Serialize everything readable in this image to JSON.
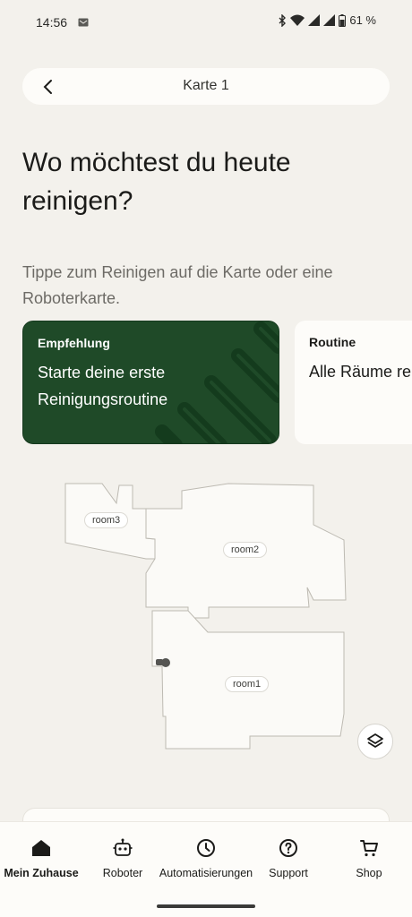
{
  "status_bar": {
    "time": "14:56",
    "battery": "61 %",
    "icons": [
      "message-icon",
      "bluetooth-icon",
      "wifi-icon",
      "signal-icon",
      "signal-icon",
      "battery-icon"
    ]
  },
  "header": {
    "title": "Karte 1",
    "back_icon": "chevron-left-icon"
  },
  "main": {
    "title": "Wo möchtest du heute reinigen?",
    "subtitle": "Tippe zum Reinigen auf die Karte oder eine Roboterkarte."
  },
  "cards": [
    {
      "kicker": "Empfehlung",
      "body": "Starte deine erste Reinigungsroutine",
      "color": "#1f4a28"
    },
    {
      "kicker": "Routine",
      "body": "Alle Räume re"
    }
  ],
  "map": {
    "rooms": [
      {
        "label": "room3"
      },
      {
        "label": "room2"
      },
      {
        "label": "room1"
      }
    ],
    "layers_icon": "layers-icon",
    "robot_icon": "robot-dock-icon"
  },
  "bottom_nav": {
    "items": [
      {
        "label": "Mein Zuhause",
        "icon": "home-icon",
        "active": true
      },
      {
        "label": "Roboter",
        "icon": "robot-icon",
        "active": false
      },
      {
        "label": "Automatisierungen",
        "icon": "clock-icon",
        "active": false
      },
      {
        "label": "Support",
        "icon": "help-icon",
        "active": false
      },
      {
        "label": "Shop",
        "icon": "cart-icon",
        "active": false
      }
    ]
  },
  "colors": {
    "background": "#f3f1ec",
    "accent_green": "#1f4a28",
    "surface": "#fdfcf9"
  }
}
